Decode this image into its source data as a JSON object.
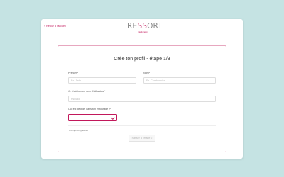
{
  "header": {
    "back_link": "< Retour à l'accueil",
    "logo": {
      "text_start": "RE",
      "text_mid": "SS",
      "text_end": "ORT",
      "tagline": "rééducation"
    }
  },
  "form": {
    "title": "Crée ton profil - étape 1/3",
    "fields": {
      "first_name": {
        "label": "Prénom*",
        "placeholder": "Ex. Jade"
      },
      "last_name": {
        "label": "Nom*",
        "placeholder": "Ex. Charbonnier"
      },
      "username": {
        "label": "Je choisis mon nom d'utilisateur*",
        "placeholder": "Pseudo"
      },
      "relationship": {
        "label": "Qui est décédé dans ton entourage ?*",
        "value": ""
      }
    },
    "required_note": "*champs obligatoires",
    "submit_label": "Passer à l'étape 2"
  },
  "colors": {
    "accent": "#c2185b",
    "background": "#c5e3e3",
    "card_border": "#e7a7bf"
  }
}
